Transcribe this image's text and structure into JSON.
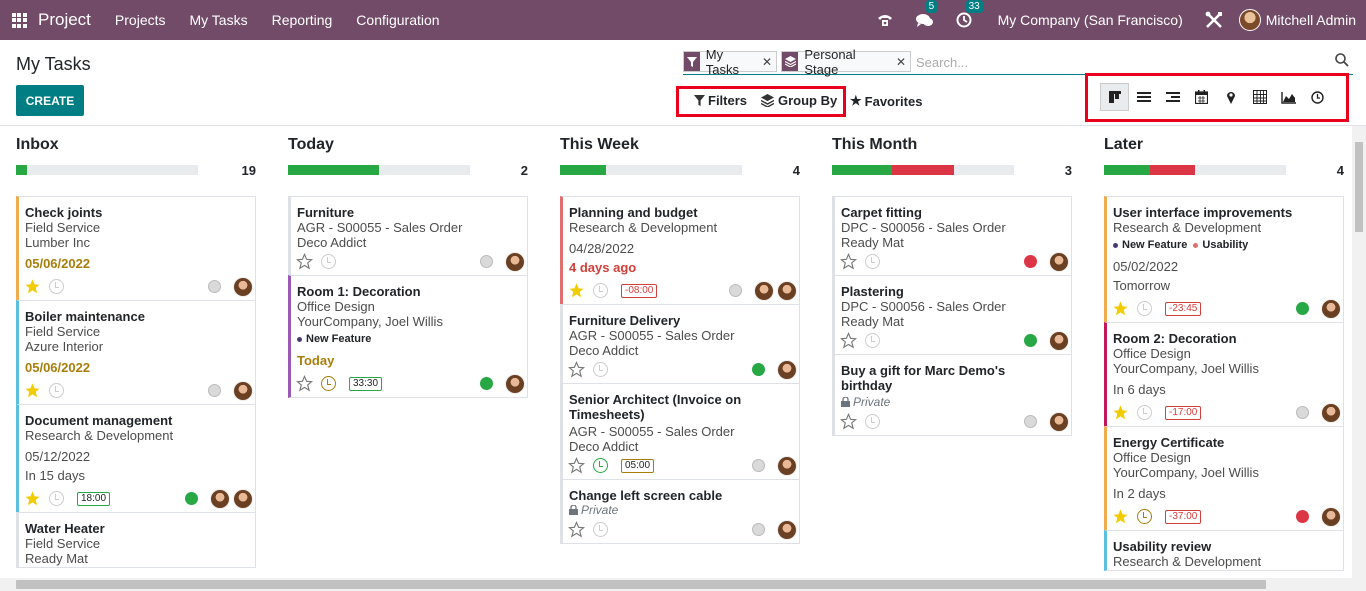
{
  "navbar": {
    "brand": "Project",
    "menus": [
      "Projects",
      "My Tasks",
      "Reporting",
      "Configuration"
    ],
    "messages_badge": "5",
    "activities_badge": "33",
    "company": "My Company (San Francisco)",
    "user": "Mitchell Admin"
  },
  "control": {
    "title": "My Tasks",
    "create_label": "CREATE",
    "facets": [
      {
        "label": "My Tasks",
        "icon": "filter-icon"
      },
      {
        "label": "Personal Stage",
        "icon": "layers-icon"
      }
    ],
    "search_placeholder": "Search...",
    "filters_label": "Filters",
    "groupby_label": "Group By",
    "favorites_label": "Favorites",
    "views": [
      "kanban-view-icon",
      "list-view-icon",
      "gantt-view-icon",
      "calendar-view-icon",
      "map-view-icon",
      "pivot-view-icon",
      "graph-view-icon",
      "activity-view-icon"
    ]
  },
  "columns": [
    {
      "title": "Inbox",
      "count": "19",
      "progress": [
        {
          "color": "#28a745",
          "pct": 6
        }
      ],
      "cards": [
        {
          "title": "Check joints",
          "lines": [
            "Field Service",
            "Lumber Inc"
          ],
          "deadline": "05/06/2022",
          "starred": true,
          "status": "grey",
          "avatars": 1,
          "border": "#f0ad4e"
        },
        {
          "title": "Boiler maintenance",
          "lines": [
            "Field Service",
            "Azure Interior"
          ],
          "deadline": "05/06/2022",
          "starred": true,
          "status": "grey",
          "avatars": 1,
          "border": "#5bc0de"
        },
        {
          "title": "Document management",
          "lines": [
            "Research & Development"
          ],
          "date": "05/12/2022",
          "relative": "In 15 days",
          "starred": true,
          "timesheet": "18:00",
          "status": "green",
          "avatars": 2,
          "border": "#5bc0de"
        },
        {
          "title": "Water Heater",
          "lines": [
            "Field Service",
            "Ready Mat"
          ],
          "border": "#dee2e6"
        }
      ]
    },
    {
      "title": "Today",
      "count": "2",
      "progress": [
        {
          "color": "#28a745",
          "pct": 50
        }
      ],
      "cards": [
        {
          "title": "Furniture",
          "lines": [
            "AGR - S00055 - Sales Order",
            "Deco Addict"
          ],
          "starred": false,
          "status": "grey",
          "avatars": 1,
          "border": "#dee2e6"
        },
        {
          "title": "Room 1: Decoration",
          "lines": [
            "Office Design",
            "YourCompany, Joel Willis"
          ],
          "tags": [
            {
              "label": "New Feature",
              "color": "#4a3b6b"
            }
          ],
          "deadline": "Today",
          "starred": false,
          "timesheet": "33:30",
          "status": "green",
          "avatars": 1,
          "border": "#9b59b6"
        }
      ]
    },
    {
      "title": "This Week",
      "count": "4",
      "progress": [
        {
          "color": "#28a745",
          "pct": 25
        }
      ],
      "cards": [
        {
          "title": "Planning and budget",
          "lines": [
            "Research & Development"
          ],
          "date": "04/28/2022",
          "late": "4 days ago",
          "starred": true,
          "timesheet": "-08:00",
          "status": "grey",
          "avatars": 2,
          "border": "#e07070"
        },
        {
          "title": "Furniture Delivery",
          "lines": [
            "AGR - S00055 - Sales Order",
            "Deco Addict"
          ],
          "starred": false,
          "status": "green",
          "avatars": 1,
          "border": "#dee2e6"
        },
        {
          "title": "Senior Architect (Invoice on Timesheets)",
          "lines": [
            "AGR - S00055 - Sales Order",
            "Deco Addict"
          ],
          "starred": false,
          "timesheet": "05:00",
          "status": "grey",
          "avatars": 1,
          "border": "#dee2e6"
        },
        {
          "title": "Change left screen cable",
          "private": "Private",
          "starred": false,
          "status": "grey",
          "avatars": 1,
          "border": "#dee2e6"
        }
      ]
    },
    {
      "title": "This Month",
      "count": "3",
      "progress": [
        {
          "color": "#28a745",
          "pct": 33
        },
        {
          "color": "#dc3545",
          "pct": 34
        }
      ],
      "cards": [
        {
          "title": "Carpet fitting",
          "lines": [
            "DPC - S00056 - Sales Order",
            "Ready Mat"
          ],
          "starred": false,
          "status": "red",
          "avatars": 1,
          "border": "#dee2e6"
        },
        {
          "title": "Plastering",
          "lines": [
            "DPC - S00056 - Sales Order",
            "Ready Mat"
          ],
          "starred": false,
          "status": "green",
          "avatars": 1,
          "border": "#dee2e6"
        },
        {
          "title": "Buy a gift for Marc Demo's birthday",
          "private": "Private",
          "starred": false,
          "status": "grey",
          "avatars": 1,
          "border": "#dee2e6"
        }
      ]
    },
    {
      "title": "Later",
      "count": "4",
      "progress": [
        {
          "color": "#28a745",
          "pct": 25
        },
        {
          "color": "#dc3545",
          "pct": 25
        }
      ],
      "cards": [
        {
          "title": "User interface improvements",
          "lines": [
            "Research & Development"
          ],
          "tags": [
            {
              "label": "New Feature",
              "color": "#4a3b6b"
            },
            {
              "label": "Usability",
              "color": "#e07070"
            }
          ],
          "date": "05/02/2022",
          "relative": "Tomorrow",
          "starred": true,
          "timesheet": "-23:45",
          "status": "green",
          "avatars": 1,
          "border": "#f0ad4e"
        },
        {
          "title": "Room 2: Decoration",
          "lines": [
            "Office Design",
            "YourCompany, Joel Willis"
          ],
          "relative": "In 6 days",
          "starred": true,
          "timesheet": "-17:00",
          "status": "grey",
          "avatars": 1,
          "border": "#c2185b"
        },
        {
          "title": "Energy Certificate",
          "lines": [
            "Office Design",
            "YourCompany, Joel Willis"
          ],
          "relative": "In 2 days",
          "starred": true,
          "timesheet": "-37:00",
          "status": "red",
          "avatars": 1,
          "border": "#f0ad4e"
        },
        {
          "title": "Usability review",
          "lines": [
            "Research & Development"
          ],
          "border": "#5bc0de"
        }
      ]
    }
  ]
}
